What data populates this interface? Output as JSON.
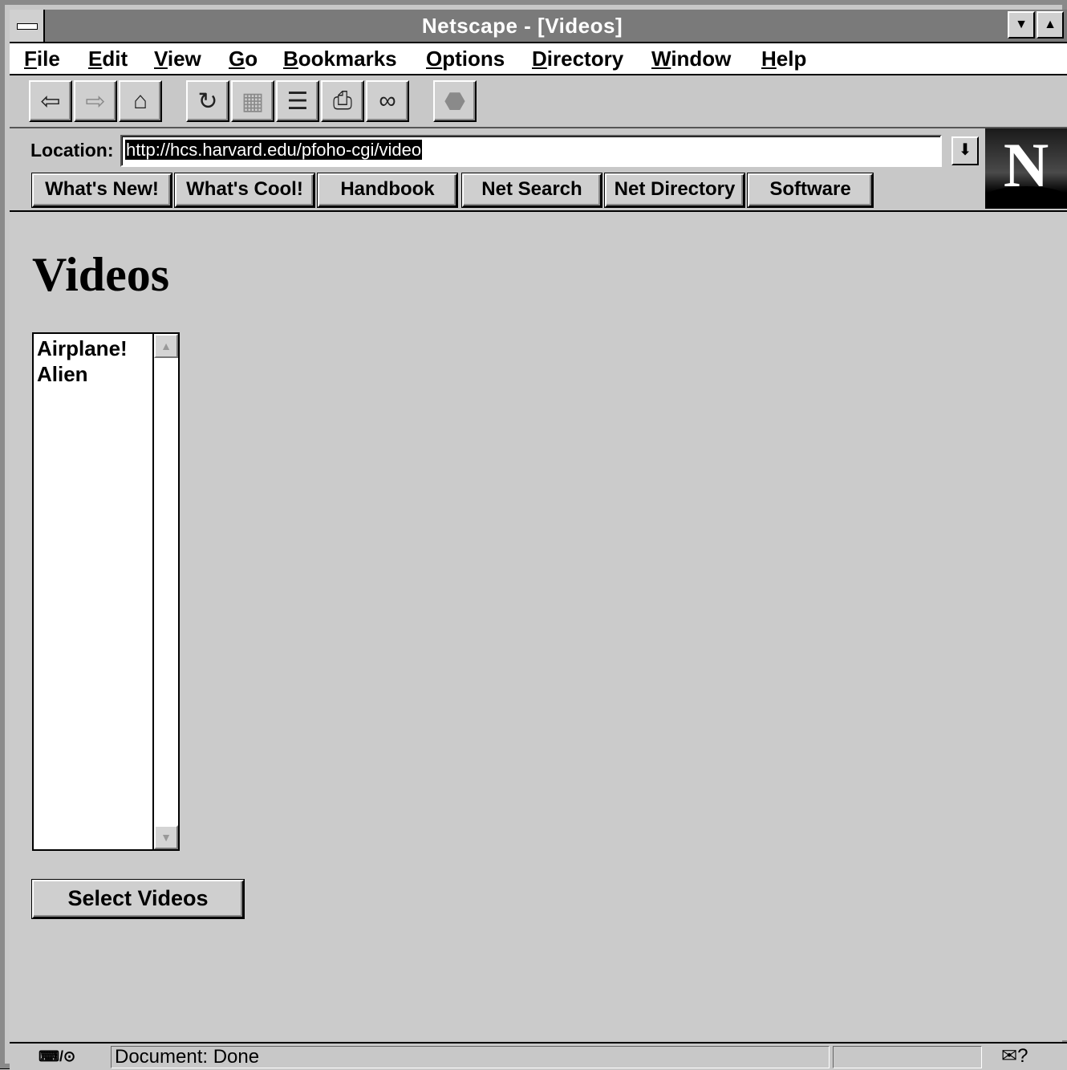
{
  "window": {
    "title": "Netscape - [Videos]",
    "minimize_glyph": "▼",
    "maximize_glyph": "▲"
  },
  "menu": {
    "items": [
      "File",
      "Edit",
      "View",
      "Go",
      "Bookmarks",
      "Options",
      "Directory",
      "Window",
      "Help"
    ]
  },
  "toolbar": {
    "buttons": [
      {
        "name": "back",
        "icon": "back-arrow-icon",
        "glyph": "⇦"
      },
      {
        "name": "forward",
        "icon": "forward-arrow-icon",
        "glyph": "⇨"
      },
      {
        "name": "home",
        "icon": "home-icon",
        "glyph": "⌂"
      },
      {
        "name": "reload",
        "icon": "reload-icon",
        "glyph": "↻"
      },
      {
        "name": "images",
        "icon": "images-icon",
        "glyph": "▦"
      },
      {
        "name": "open",
        "icon": "open-icon",
        "glyph": "☰"
      },
      {
        "name": "print",
        "icon": "print-icon",
        "glyph": "⎙"
      },
      {
        "name": "find",
        "icon": "find-binoculars-icon",
        "glyph": "∞"
      },
      {
        "name": "stop",
        "icon": "stop-icon",
        "glyph": "⬣"
      }
    ]
  },
  "location": {
    "label": "Location:",
    "url": "http://hcs.harvard.edu/pfoho-cgi/video",
    "dropdown_glyph": "⬇"
  },
  "directory_buttons": [
    "What's New!",
    "What's Cool!",
    "Handbook",
    "Net Search",
    "Net Directory",
    "Software"
  ],
  "logo": {
    "letter": "N"
  },
  "page": {
    "heading": "Videos",
    "list_options": [
      "Airplane!",
      "Alien"
    ],
    "scroll_up_glyph": "▲",
    "scroll_down_glyph": "▼",
    "submit_label": "Select Videos"
  },
  "status": {
    "security_glyph": "⌨/⊙",
    "text": "Document: Done",
    "mail_glyph": "✉?"
  }
}
